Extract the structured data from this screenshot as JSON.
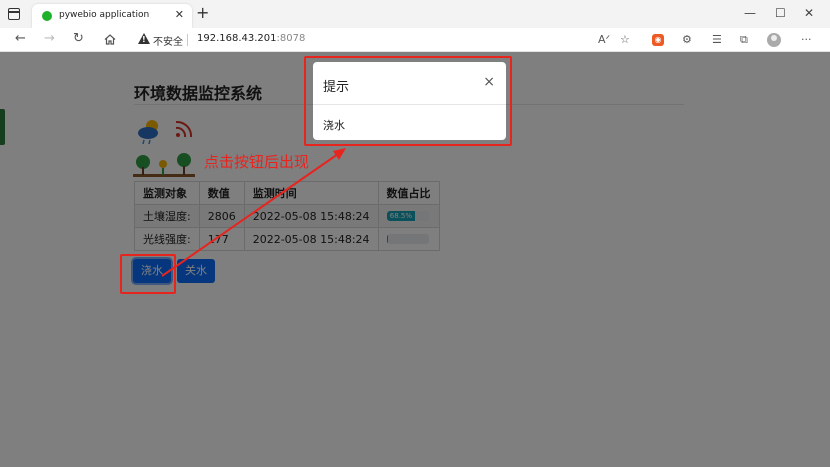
{
  "browser": {
    "tab_title": "pywebio application",
    "security_label": "不安全",
    "url_host": "192.168.43.201",
    "url_port": ":8078"
  },
  "app": {
    "title": "环境数据监控系统",
    "table": {
      "headers": [
        "监测对象",
        "数值",
        "监测时间",
        "数值占比"
      ],
      "rows": [
        {
          "name": "土壤湿度:",
          "value": "2806",
          "time": "2022-05-08 15:48:24",
          "percent_label": "68.5%",
          "percent": 68.5
        },
        {
          "name": "光线强度:",
          "value": "177",
          "time": "2022-05-08 15:48:24",
          "percent_label": "",
          "percent": 4.3
        }
      ]
    },
    "buttons": {
      "water": "浇水",
      "stop_water": "关水"
    }
  },
  "modal": {
    "title": "提示",
    "close": "×",
    "body": "浇水"
  },
  "annotation": {
    "text": "点击按钮后出现",
    "color": "#e8241f"
  }
}
